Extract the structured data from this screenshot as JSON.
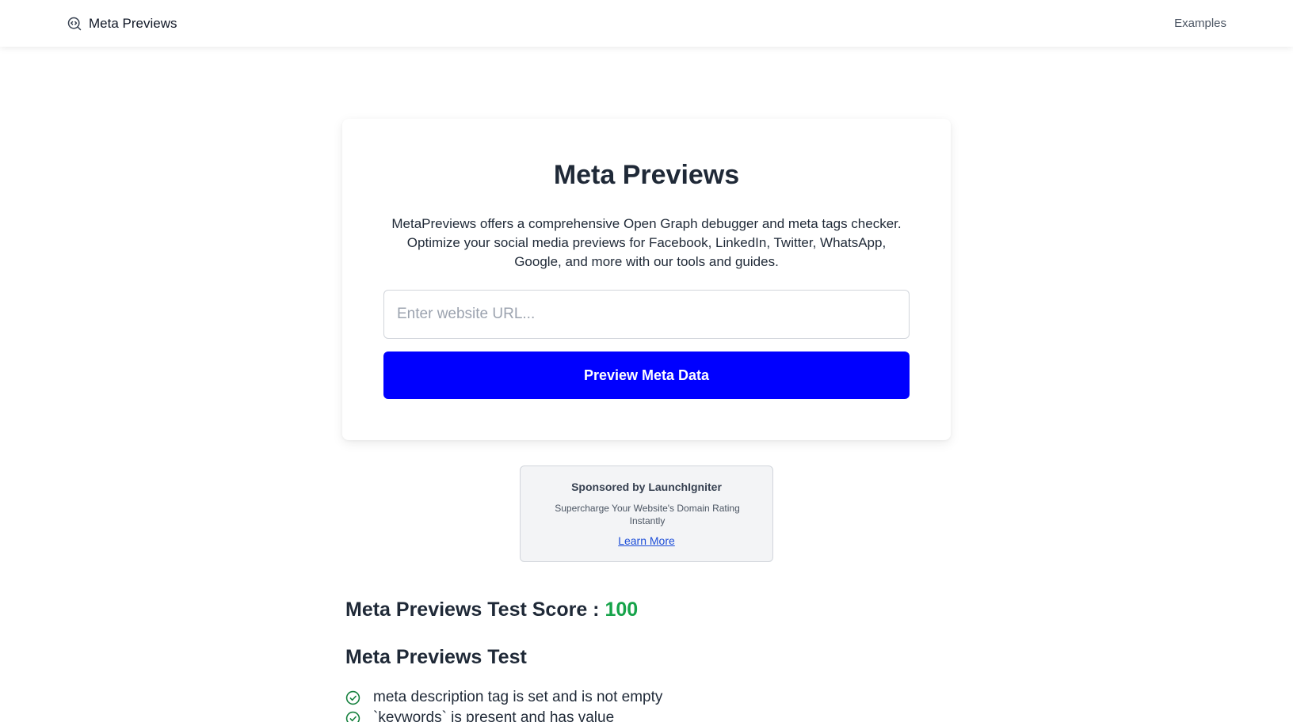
{
  "header": {
    "brand": "Meta Previews",
    "nav_examples": "Examples"
  },
  "hero": {
    "title": "Meta Previews",
    "description": "MetaPreviews offers a comprehensive Open Graph debugger and meta tags checker. Optimize your social media previews for Facebook, LinkedIn, Twitter, WhatsApp, Google, and more with our tools and guides.",
    "input_placeholder": "Enter website URL...",
    "input_value": "",
    "button_label": "Preview Meta Data"
  },
  "sponsor": {
    "title": "Sponsored by LaunchIgniter",
    "description": "Supercharge Your Website's Domain Rating Instantly",
    "link": "Learn More"
  },
  "results": {
    "score_label": "Meta Previews Test Score :",
    "score_value": "100",
    "test_heading": "Meta Previews Test",
    "checks": [
      "meta description tag is set and is not empty",
      "`keywords` is present and has value"
    ]
  },
  "colors": {
    "primary_button": "#0000ff",
    "score_green": "#16a34a",
    "check_green": "#15803d",
    "link_blue": "#1d4ed8"
  },
  "icons": {
    "brand": "search-code-icon",
    "check": "check-circle-icon"
  }
}
